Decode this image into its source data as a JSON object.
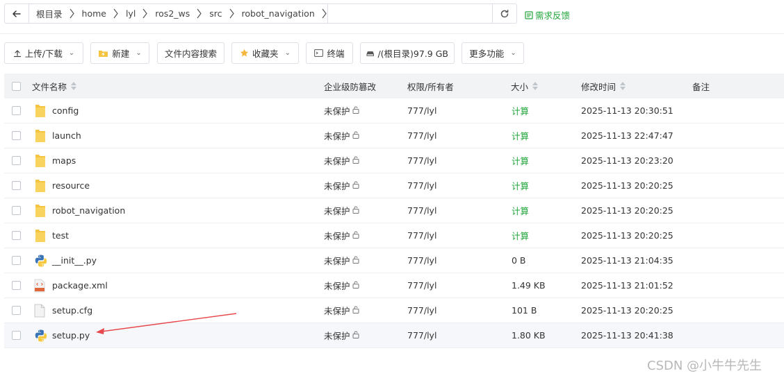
{
  "breadcrumb": {
    "items": [
      "根目录",
      "home",
      "lyl",
      "ros2_ws",
      "src",
      "robot_navigation"
    ]
  },
  "feedback_label": "需求反馈",
  "toolbar": {
    "upload": "上传/下载",
    "new": "新建",
    "search_content": "文件内容搜索",
    "favorites": "收藏夹",
    "terminal": "终端",
    "disk": "/(根目录)97.9 GB",
    "more": "更多功能"
  },
  "table": {
    "headers": {
      "name": "文件名称",
      "protect": "企业级防篡改",
      "perm": "权限/所有者",
      "size": "大小",
      "mtime": "修改时间",
      "note": "备注"
    },
    "rows": [
      {
        "icon": "folder",
        "name": "config",
        "protect": "未保护",
        "perm": "777/lyl",
        "size": "计算",
        "size_is_calc": true,
        "mtime": "2025-11-13 20:30:51"
      },
      {
        "icon": "folder",
        "name": "launch",
        "protect": "未保护",
        "perm": "777/lyl",
        "size": "计算",
        "size_is_calc": true,
        "mtime": "2025-11-13 22:47:47"
      },
      {
        "icon": "folder",
        "name": "maps",
        "protect": "未保护",
        "perm": "777/lyl",
        "size": "计算",
        "size_is_calc": true,
        "mtime": "2025-11-13 20:23:20"
      },
      {
        "icon": "folder",
        "name": "resource",
        "protect": "未保护",
        "perm": "777/lyl",
        "size": "计算",
        "size_is_calc": true,
        "mtime": "2025-11-13 20:20:25"
      },
      {
        "icon": "folder",
        "name": "robot_navigation",
        "protect": "未保护",
        "perm": "777/lyl",
        "size": "计算",
        "size_is_calc": true,
        "mtime": "2025-11-13 20:20:25"
      },
      {
        "icon": "folder",
        "name": "test",
        "protect": "未保护",
        "perm": "777/lyl",
        "size": "计算",
        "size_is_calc": true,
        "mtime": "2025-11-13 20:20:25"
      },
      {
        "icon": "python",
        "name": "__init__.py",
        "protect": "未保护",
        "perm": "777/lyl",
        "size": "0 B",
        "size_is_calc": false,
        "mtime": "2025-11-13 21:04:35"
      },
      {
        "icon": "xml",
        "name": "package.xml",
        "protect": "未保护",
        "perm": "777/lyl",
        "size": "1.49 KB",
        "size_is_calc": false,
        "mtime": "2025-11-13 21:01:52"
      },
      {
        "icon": "file",
        "name": "setup.cfg",
        "protect": "未保护",
        "perm": "777/lyl",
        "size": "101 B",
        "size_is_calc": false,
        "mtime": "2025-11-13 20:20:25"
      },
      {
        "icon": "python",
        "name": "setup.py",
        "protect": "未保护",
        "perm": "777/lyl",
        "size": "1.80 KB",
        "size_is_calc": false,
        "mtime": "2025-11-13 20:41:38"
      }
    ]
  },
  "colors": {
    "accent_green": "#20a53a",
    "folder_yellow": "#f5c542",
    "annotation_arrow": "#e8474c"
  },
  "watermark": "CSDN @小牛牛先生"
}
